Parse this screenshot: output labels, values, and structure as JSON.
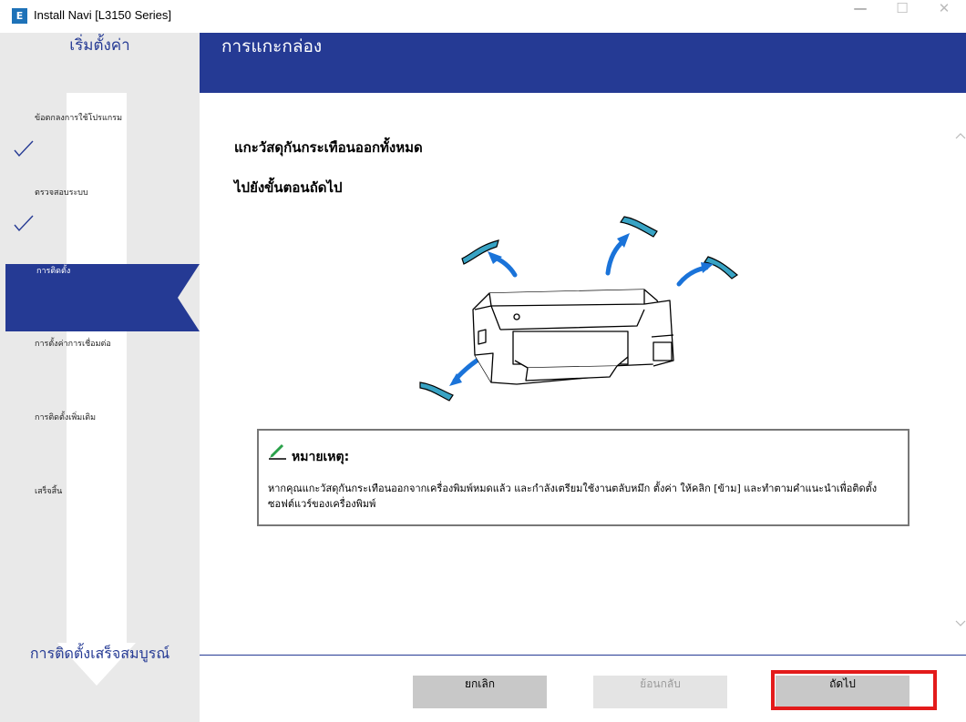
{
  "window": {
    "title": "Install Navi [L3150 Series]",
    "app_icon": "E",
    "minimize": "—",
    "maximize": "☐",
    "close": "✕"
  },
  "sidebar": {
    "header": "เริ่มตั้งค่า",
    "steps": [
      {
        "label": "ข้อตกลงการใช้โปรแกรม",
        "state": "done"
      },
      {
        "label": "ตรวจสอบระบบ",
        "state": "done"
      },
      {
        "label": "การติดตั้ง",
        "state": "active"
      },
      {
        "label": "การตั้งค่าการเชื่อมต่อ",
        "state": "pending"
      },
      {
        "label": "การติดตั้งเพิ่มเติม",
        "state": "pending"
      },
      {
        "label": "เสร็จสิ้น",
        "state": "pending"
      }
    ],
    "footer": "การติดตั้งเสร็จสมบูรณ์"
  },
  "main": {
    "title": "การแกะกล่อง",
    "instruction_1": "แกะวัสดุกันกระเทือนออกทั้งหมด",
    "instruction_2": "ไปยังขั้นตอนถัดไป",
    "note": {
      "title": "หมายเหตุ:",
      "text": "หากคุณแกะวัสดุกันกระเทือนออกจากเครื่องพิมพ์หมดแล้ว และกำลังเตรียมใช้งานตลับหมึก ตั้งค่า ให้คลิก [ข้าม] และทำตามคำแนะนำเพื่อติดตั้งซอฟต์แวร์ของเครื่องพิมพ์"
    }
  },
  "buttons": {
    "cancel": "ยกเลิก",
    "back": "ย้อนกลับ",
    "next": "ถัดไป"
  },
  "colors": {
    "brand": "#253a94",
    "sidebar_bg": "#e9e9e9",
    "highlight": "#e31b1b",
    "arrow_blue": "#1a73d9",
    "packing_teal": "#38a3c4"
  }
}
